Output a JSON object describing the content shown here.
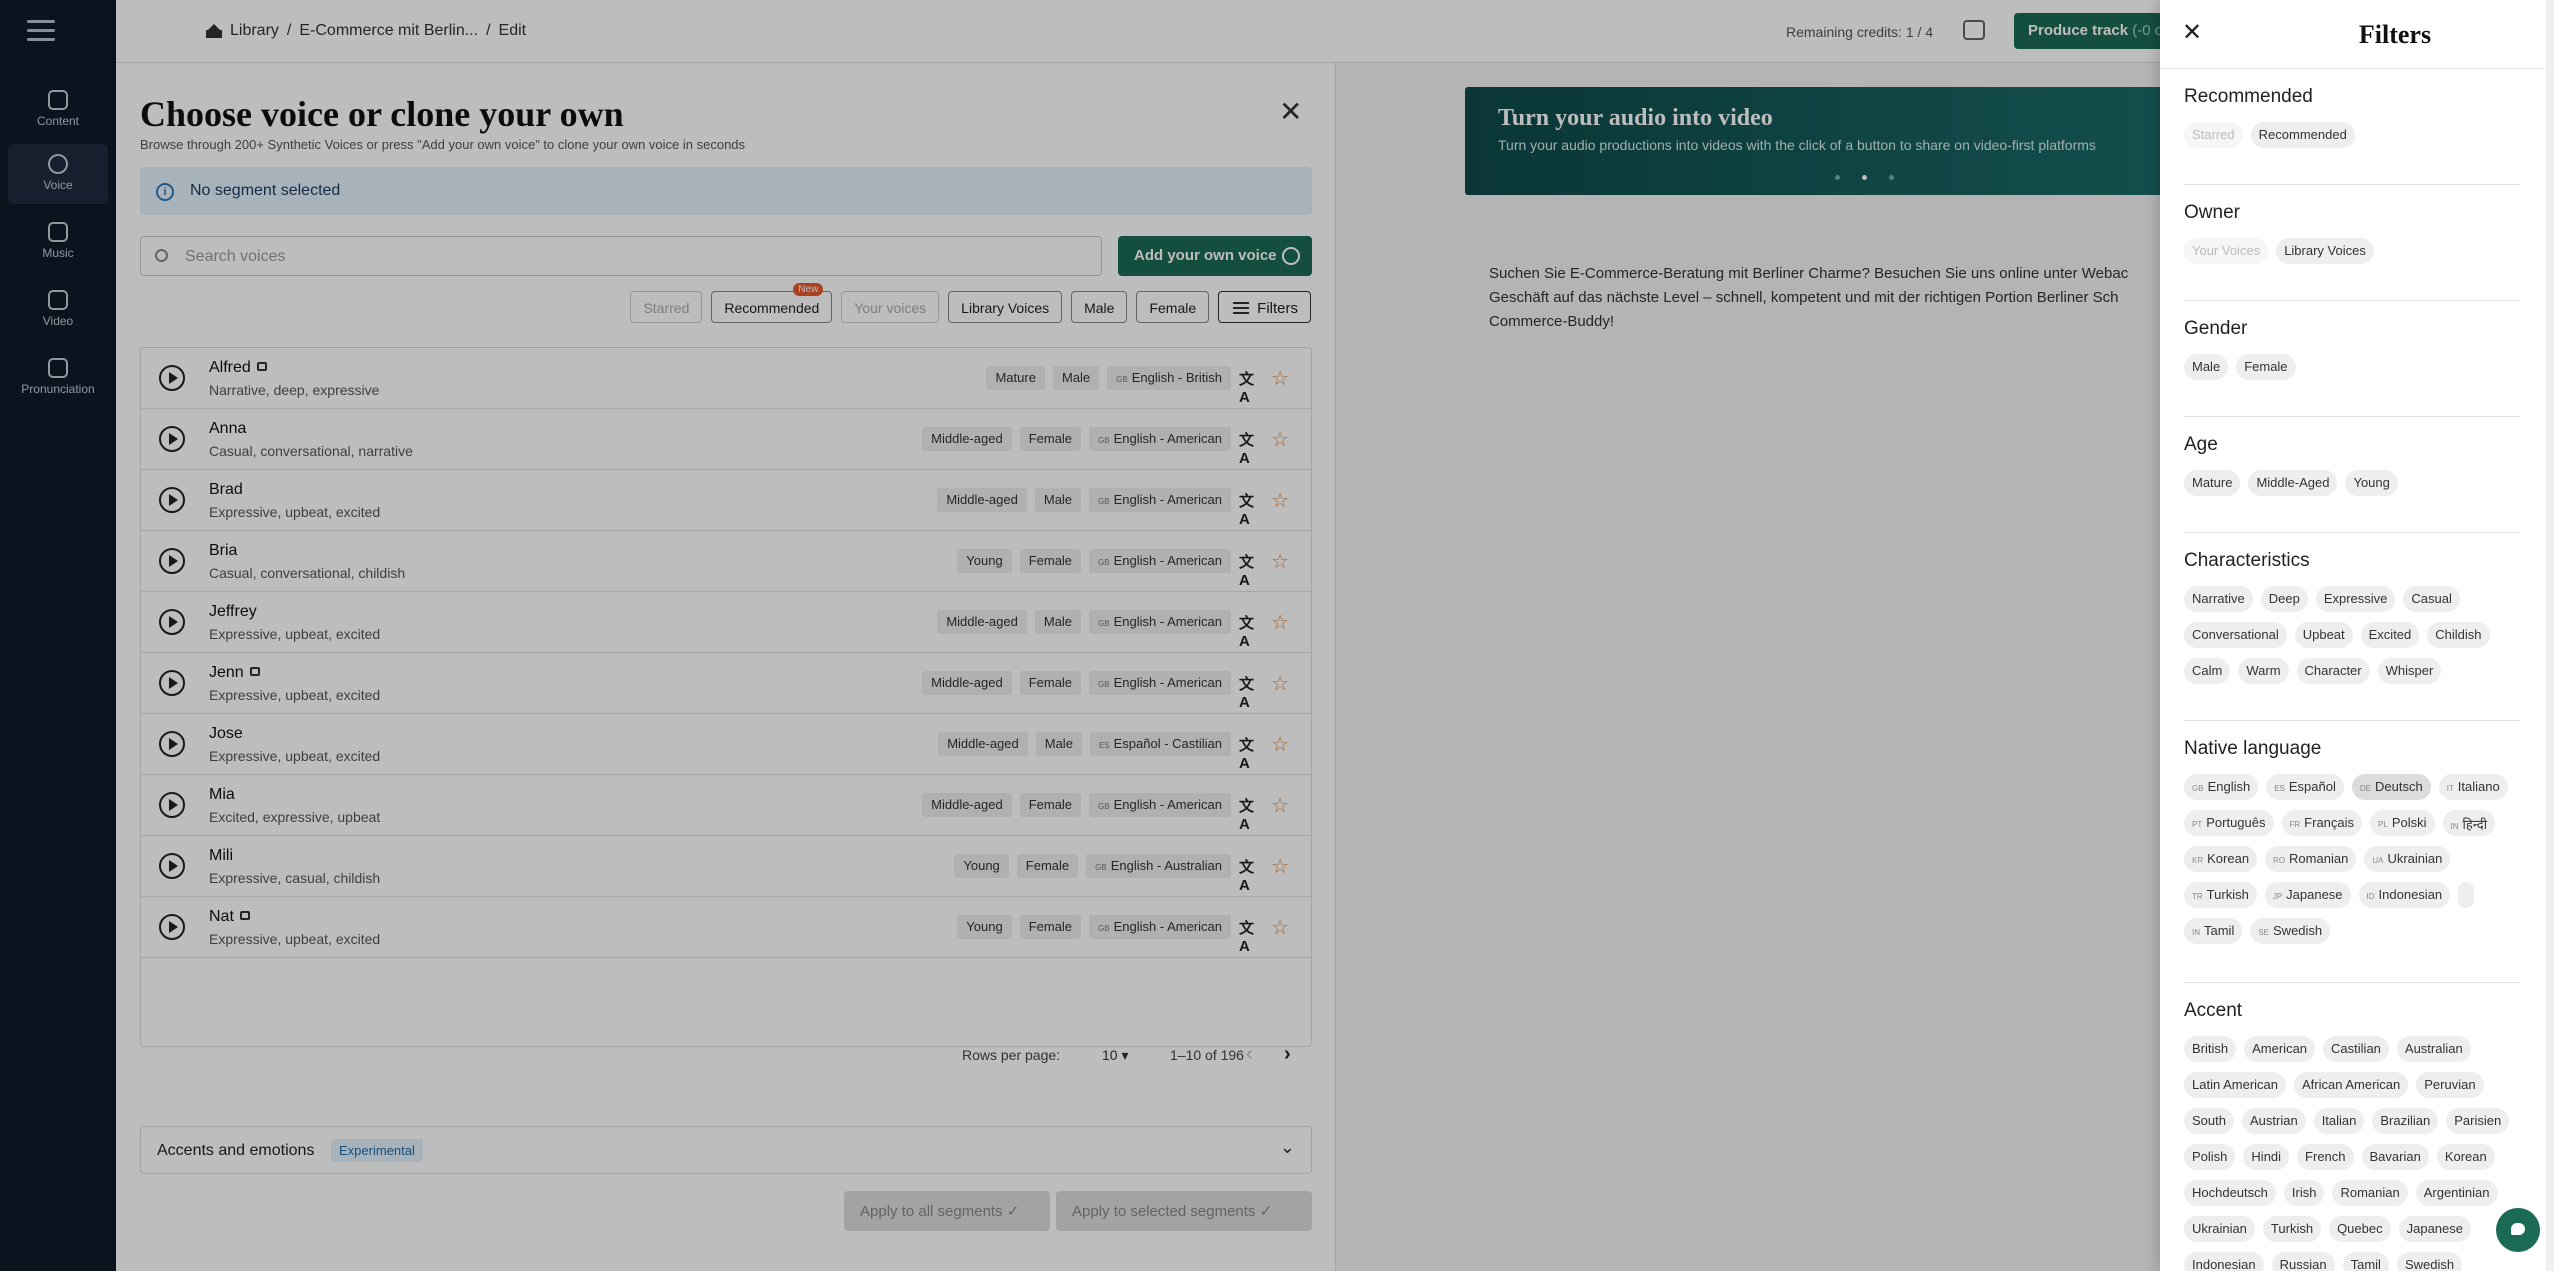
{
  "sidebar": {
    "items": [
      {
        "label": "Content",
        "icon": "document-icon"
      },
      {
        "label": "Voice",
        "icon": "voice-icon"
      },
      {
        "label": "Music",
        "icon": "music-icon"
      },
      {
        "label": "Video",
        "icon": "video-icon"
      },
      {
        "label": "Pronunciation",
        "icon": "pronunciation-icon"
      }
    ]
  },
  "topbar": {
    "breadcrumb": [
      "Library",
      "E-Commerce mit Berlin...",
      "Edit"
    ],
    "credits": "Remaining credits: 1 / 4",
    "produce_label": "Produce track",
    "produce_credits": "(-0 c"
  },
  "modal": {
    "title": "Choose voice or clone your own",
    "subtitle": "Browse through 200+ Synthetic Voices or press \"Add your own voice\" to clone your own voice in seconds",
    "notice": "No segment selected",
    "search_placeholder": "Search voices",
    "add_voice_label": "Add your own voice",
    "chips": {
      "starred": "Starred",
      "recommended": "Recommended",
      "new_badge": "New",
      "your_voices": "Your voices",
      "library_voices": "Library Voices",
      "male": "Male",
      "female": "Female",
      "filters": "Filters"
    },
    "voices": [
      {
        "name": "Alfred",
        "locked": true,
        "desc": "Narrative, deep, expressive",
        "age": "Mature",
        "gender": "Male",
        "cc": "GB",
        "lang": "English - British"
      },
      {
        "name": "Anna",
        "locked": false,
        "desc": "Casual, conversational, narrative",
        "age": "Middle-aged",
        "gender": "Female",
        "cc": "GB",
        "lang": "English - American"
      },
      {
        "name": "Brad",
        "locked": false,
        "desc": "Expressive, upbeat, excited",
        "age": "Middle-aged",
        "gender": "Male",
        "cc": "GB",
        "lang": "English - American"
      },
      {
        "name": "Bria",
        "locked": false,
        "desc": "Casual, conversational, childish",
        "age": "Young",
        "gender": "Female",
        "cc": "GB",
        "lang": "English - American"
      },
      {
        "name": "Jeffrey",
        "locked": false,
        "desc": "Expressive, upbeat, excited",
        "age": "Middle-aged",
        "gender": "Male",
        "cc": "GB",
        "lang": "English - American"
      },
      {
        "name": "Jenn",
        "locked": true,
        "desc": "Expressive, upbeat, excited",
        "age": "Middle-aged",
        "gender": "Female",
        "cc": "GB",
        "lang": "English - American"
      },
      {
        "name": "Jose",
        "locked": false,
        "desc": "Expressive, upbeat, excited",
        "age": "Middle-aged",
        "gender": "Male",
        "cc": "ES",
        "lang": "Español - Castilian"
      },
      {
        "name": "Mia",
        "locked": false,
        "desc": "Excited, expressive, upbeat",
        "age": "Middle-aged",
        "gender": "Female",
        "cc": "GB",
        "lang": "English - American"
      },
      {
        "name": "Mili",
        "locked": false,
        "desc": "Expressive, casual, childish",
        "age": "Young",
        "gender": "Female",
        "cc": "GB",
        "lang": "English - Australian"
      },
      {
        "name": "Nat",
        "locked": true,
        "desc": "Expressive, upbeat, excited",
        "age": "Young",
        "gender": "Female",
        "cc": "GB",
        "lang": "English - American"
      }
    ],
    "pager": {
      "rows_label": "Rows per page:",
      "rows_value": "10",
      "range": "1–10 of 196"
    },
    "accents_label": "Accents and emotions",
    "experimental": "Experimental",
    "apply_all": "Apply to all segments",
    "apply_selected": "Apply to selected segments"
  },
  "promo": {
    "title": "Turn your audio into video",
    "subtitle": "Turn your audio productions into videos with the click of a button to share on video-first platforms"
  },
  "script_text": "Suchen Sie E-Commerce-Beratung mit Berliner Charme? Besuchen Sie uns online unter Webac Geschäft auf das nächste Level – schnell, kompetent und mit der richtigen Portion Berliner Sch Commerce-Buddy!",
  "filters": {
    "title": "Filters",
    "sections": [
      {
        "title": "Recommended",
        "chips": [
          {
            "label": "Starred",
            "state": "disabled"
          },
          {
            "label": "Recommended",
            "state": "normal"
          }
        ]
      },
      {
        "title": "Owner",
        "chips": [
          {
            "label": "Your Voices",
            "state": "disabled"
          },
          {
            "label": "Library Voices",
            "state": "normal"
          }
        ]
      },
      {
        "title": "Gender",
        "chips": [
          {
            "label": "Male"
          },
          {
            "label": "Female"
          }
        ]
      },
      {
        "title": "Age",
        "chips": [
          {
            "label": "Mature"
          },
          {
            "label": "Middle-Aged"
          },
          {
            "label": "Young"
          }
        ]
      },
      {
        "title": "Characteristics",
        "chips": [
          {
            "label": "Narrative"
          },
          {
            "label": "Deep"
          },
          {
            "label": "Expressive"
          },
          {
            "label": "Casual"
          },
          {
            "label": "Conversational"
          },
          {
            "label": "Upbeat"
          },
          {
            "label": "Excited"
          },
          {
            "label": "Childish"
          },
          {
            "label": "Calm"
          },
          {
            "label": "Warm"
          },
          {
            "label": "Character"
          },
          {
            "label": "Whisper"
          }
        ]
      },
      {
        "title": "Native language",
        "chips": [
          {
            "cc": "GB",
            "label": "English"
          },
          {
            "cc": "ES",
            "label": "Español"
          },
          {
            "cc": "DE",
            "label": "Deutsch",
            "state": "selected"
          },
          {
            "cc": "IT",
            "label": "Italiano"
          },
          {
            "cc": "PT",
            "label": "Português"
          },
          {
            "cc": "FR",
            "label": "Français"
          },
          {
            "cc": "PL",
            "label": "Polski"
          },
          {
            "cc": "IN",
            "label": "हिन्दी"
          },
          {
            "cc": "KR",
            "label": "Korean"
          },
          {
            "cc": "RO",
            "label": "Romanian"
          },
          {
            "cc": "UA",
            "label": "Ukrainian"
          },
          {
            "cc": "TR",
            "label": "Turkish"
          },
          {
            "cc": "JP",
            "label": "Japanese"
          },
          {
            "cc": "ID",
            "label": "Indonesian"
          },
          {
            "cc": "",
            "label": ""
          },
          {
            "cc": "IN",
            "label": "Tamil"
          },
          {
            "cc": "SE",
            "label": "Swedish"
          }
        ]
      },
      {
        "title": "Accent",
        "chips": [
          {
            "label": "British"
          },
          {
            "label": "American"
          },
          {
            "label": "Castilian"
          },
          {
            "label": "Australian"
          },
          {
            "label": "Latin American"
          },
          {
            "label": "African American"
          },
          {
            "label": "Peruvian"
          },
          {
            "label": "South"
          },
          {
            "label": "Austrian"
          },
          {
            "label": "Italian"
          },
          {
            "label": "Brazilian"
          },
          {
            "label": "Parisien"
          },
          {
            "label": "Polish"
          },
          {
            "label": "Hindi"
          },
          {
            "label": "French"
          },
          {
            "label": "Bavarian"
          },
          {
            "label": "Korean"
          },
          {
            "label": "Hochdeutsch"
          },
          {
            "label": "Irish"
          },
          {
            "label": "Romanian"
          },
          {
            "label": "Argentinian"
          },
          {
            "label": "Ukrainian"
          },
          {
            "label": "Turkish"
          },
          {
            "label": "Quebec"
          },
          {
            "label": "Japanese"
          },
          {
            "label": "Indonesian"
          },
          {
            "label": "Russian"
          },
          {
            "label": "Tamil"
          },
          {
            "label": "Swedish"
          }
        ]
      }
    ]
  }
}
